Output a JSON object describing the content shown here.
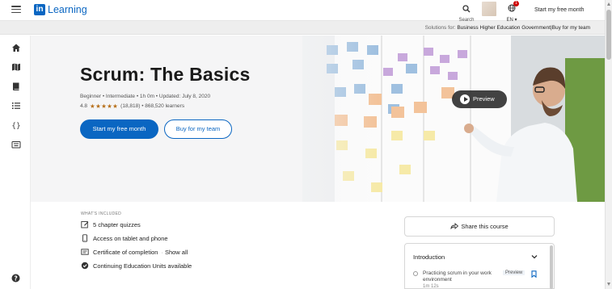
{
  "topbar": {
    "logo_mark": "in",
    "logo_text": "Learning",
    "search_label": "Search",
    "lang_label": "EN ▾",
    "notification_count": "1",
    "cta": "Start my free month"
  },
  "solutions": {
    "prefix": "Solutions for:",
    "items": [
      "Business",
      "Higher Education",
      "Government",
      "|",
      "Buy for my team"
    ]
  },
  "course": {
    "title": "Scrum: The Basics",
    "meta": "Beginner • Intermediate • 1h 0m • Updated: July 8, 2020",
    "rating_value": "4.8",
    "stars": "★★★★★",
    "rating_count": "(18,818)",
    "learners": "• 868,520 learners",
    "primary_button": "Start my free month",
    "secondary_button": "Buy for my team",
    "preview_button": "Preview"
  },
  "included": {
    "heading": "WHAT'S INCLUDED",
    "items": [
      {
        "label": "5 chapter quizzes"
      },
      {
        "label": "Access on tablet and phone"
      },
      {
        "label": "Certificate of completion",
        "extra": "·",
        "link": "Show all"
      },
      {
        "label": "Continuing Education Units available"
      }
    ]
  },
  "share": {
    "label": "Share this course"
  },
  "toc": {
    "section": "Introduction",
    "item": "Practicing scrum in your work environment",
    "badge": "Preview",
    "duration": "1m 12s"
  },
  "colors": {
    "brand": "#0a66c2",
    "star": "#b7701b"
  }
}
